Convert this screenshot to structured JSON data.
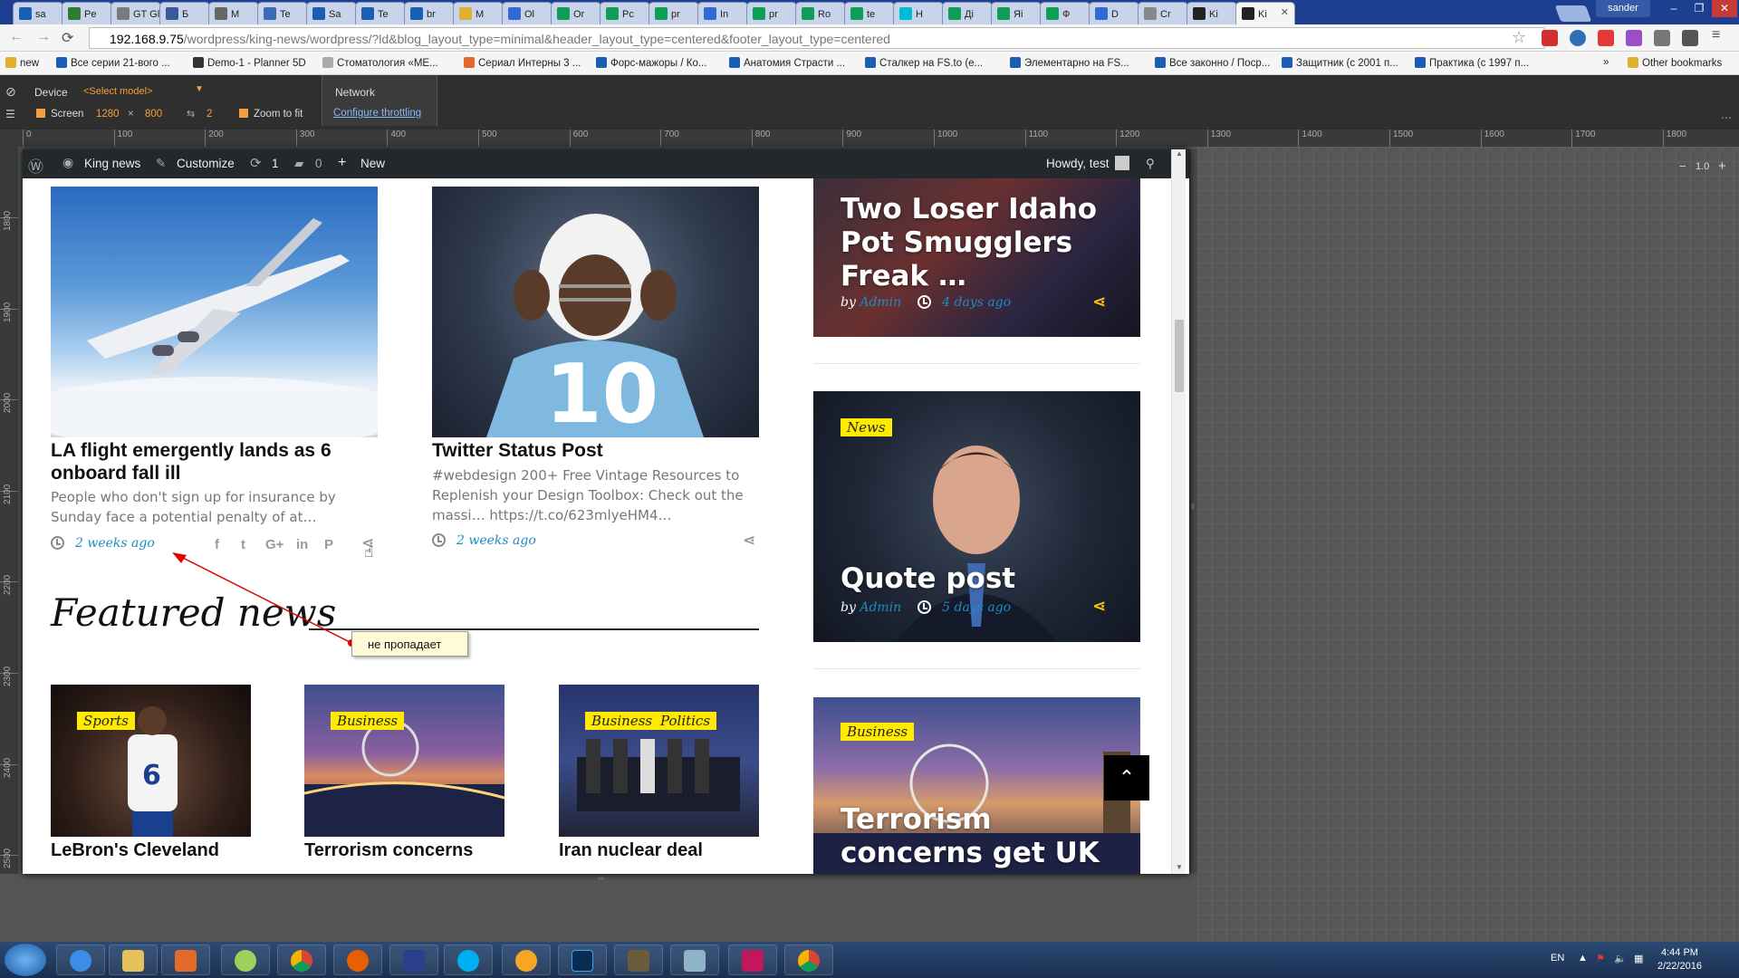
{
  "browser": {
    "tabs": [
      {
        "label": "sa",
        "color": "#1a5fb4"
      },
      {
        "label": "Pe",
        "color": "#2e7d32"
      },
      {
        "label": "GT Gl",
        "color": "#7a7a7a"
      },
      {
        "label": "Б",
        "color": "#3b5998"
      },
      {
        "label": "M",
        "color": "#666666"
      },
      {
        "label": "Te",
        "color": "#3d6bb3"
      },
      {
        "label": "Sa",
        "color": "#1a5fb4"
      },
      {
        "label": "Te",
        "color": "#1a5fb4"
      },
      {
        "label": "br",
        "color": "#1a5fb4"
      },
      {
        "label": "M",
        "color": "#e0b030"
      },
      {
        "label": "Ol",
        "color": "#3367d6"
      },
      {
        "label": "Or",
        "color": "#0f9d58"
      },
      {
        "label": "Pc",
        "color": "#0f9d58"
      },
      {
        "label": "pr",
        "color": "#0f9d58"
      },
      {
        "label": "In",
        "color": "#3367d6"
      },
      {
        "label": "pr",
        "color": "#0f9d58"
      },
      {
        "label": "Ro",
        "color": "#0f9d58"
      },
      {
        "label": "te",
        "color": "#0f9d58"
      },
      {
        "label": "H",
        "color": "#00bcd4"
      },
      {
        "label": "Дi",
        "color": "#0f9d58"
      },
      {
        "label": "Яi",
        "color": "#0f9d58"
      },
      {
        "label": "Ф",
        "color": "#0f9d58"
      },
      {
        "label": "D",
        "color": "#3367d6"
      },
      {
        "label": "Cr",
        "color": "#888888"
      },
      {
        "label": "Ki",
        "color": "#222222"
      },
      {
        "label": "Ki",
        "color": "#222222",
        "active": true
      }
    ],
    "profile": "sander",
    "url_host": "192.168.9.75",
    "url_path": "/wordpress/king-news/wordpress/?ld&blog_layout_type=minimal&header_layout_type=centered&footer_layout_type=centered",
    "bookmarks": [
      "new",
      "Все серии 21-вого ...",
      "Demo-1 - Planner 5D",
      "Стоматология «МЕ...",
      "Сериал Интерны 3 ...",
      "Форс-мажоры / Ко...",
      "Анатомия Страсти ...",
      "Сталкер на FS.to (e...",
      "Элементарно на FS...",
      "Все законно / Поср...",
      "Защитник (с 2001 п...",
      "Практика (с 1997 п...",
      "»",
      "Other bookmarks"
    ]
  },
  "devtools": {
    "device_label": "Device",
    "model_select": "<Select model>",
    "screen_label": "Screen",
    "screen_w": "1280",
    "screen_x": "×",
    "screen_h": "800",
    "dpr": "2",
    "zoom_to_fit": "Zoom to fit",
    "network_label": "Network",
    "throttling_link": "Configure throttling",
    "zoom_value": "1.0",
    "ruler_h": [
      "0",
      "100",
      "200",
      "300",
      "400",
      "500",
      "600",
      "700",
      "800",
      "900",
      "1000",
      "1100",
      "1200",
      "1300",
      "1400",
      "1500",
      "1600",
      "1700",
      "1800"
    ],
    "ruler_v": [
      "1800",
      "1900",
      "2000",
      "2100",
      "2200",
      "2300",
      "2400",
      "2500"
    ]
  },
  "adminbar": {
    "site": "King news",
    "customize": "Customize",
    "updates": "1",
    "comments": "0",
    "new": "New",
    "howdy": "Howdy, test"
  },
  "posts": [
    {
      "title": "LA flight emergently lands as 6 onboard fall ill",
      "excerpt": "People who don't sign up for insurance by Sunday face a potential penalty of at…",
      "date": "2 weeks ago",
      "social": [
        "f",
        "t",
        "G+",
        "in",
        "P"
      ]
    },
    {
      "title": "Twitter Status Post",
      "excerpt": "#webdesign 200+ Free Vintage Resources to Replenish your Design Toolbox: Check out the massi… https://t.co/623mlyeHM4…",
      "date": "2 weeks ago"
    }
  ],
  "featured": {
    "heading": "Featured news",
    "items": [
      {
        "tag": "Sports",
        "title": "LeBron's Cleveland"
      },
      {
        "tags": [
          "Business"
        ],
        "title": "Terrorism concerns"
      },
      {
        "tags": [
          "Business",
          "Politics"
        ],
        "title": "Iran nuclear deal"
      }
    ]
  },
  "sidebar": [
    {
      "title": "Two Loser Idaho Pot Smugglers Freak …",
      "by": "by",
      "author": "Admin",
      "date": "4 days ago"
    },
    {
      "tag": "News",
      "title": "Quote post",
      "by": "by",
      "author": "Admin",
      "date": "5 days ago"
    },
    {
      "tag": "Business",
      "title": "Terrorism concerns get UK tourists"
    }
  ],
  "annotation": "не пропадает",
  "taskbar": {
    "lang": "EN",
    "time": "4:44 PM",
    "date": "2/22/2016"
  },
  "colors": {
    "accent_link": "#1e8bc3",
    "tag_bg": "#ffea00",
    "share_icon": "#ffc400",
    "adminbar_bg": "#23282d",
    "annotation_arrow": "#e00000"
  }
}
